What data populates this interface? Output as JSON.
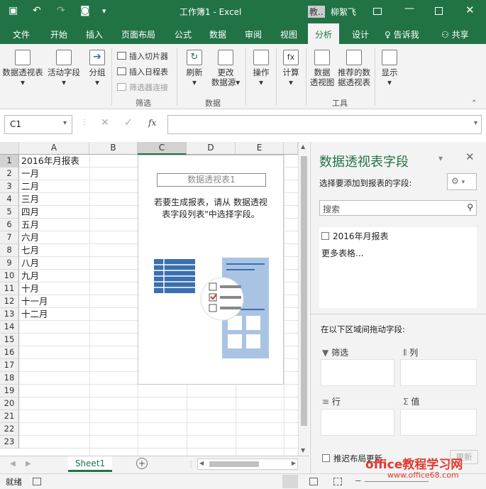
{
  "window": {
    "title": "工作簿1 - Excel",
    "user_short": "教..",
    "user": "柳絮飞"
  },
  "tabs": [
    "文件",
    "开始",
    "插入",
    "页面布局",
    "公式",
    "数据",
    "审阅",
    "视图",
    "分析",
    "设计"
  ],
  "tell_me": "告诉我",
  "share": "共享",
  "ribbon": {
    "pivot_table": "数据透视表",
    "active_field": "活动字段",
    "group": "分组",
    "insert_slicer": "插入切片器",
    "insert_timeline": "插入日程表",
    "filter_connections": "筛选器连接",
    "filter_group": "筛选",
    "refresh": "刷新",
    "change_source_1": "更改",
    "change_source_2": "数据源",
    "data_group": "数据",
    "actions": "操作",
    "calculations": "计算",
    "pivot_chart_1": "数据",
    "pivot_chart_2": "透视图",
    "recommended_1": "推荐的数",
    "recommended_2": "据透视表",
    "tools_group": "工具",
    "show": "显示"
  },
  "formula_bar": {
    "name_box": "C1",
    "fx": "fx"
  },
  "columns": [
    "A",
    "B",
    "C",
    "D",
    "E"
  ],
  "rows": [
    "1",
    "2",
    "3",
    "4",
    "5",
    "6",
    "7",
    "8",
    "9",
    "10",
    "11",
    "12",
    "13",
    "14",
    "15",
    "16",
    "17",
    "18",
    "19",
    "20",
    "21",
    "22",
    "23"
  ],
  "cells_a": [
    "2016年月报表",
    "一月",
    "二月",
    "三月",
    "四月",
    "五月",
    "六月",
    "七月",
    "八月",
    "九月",
    "十月",
    "十一月",
    "十二月"
  ],
  "pivot_placeholder": {
    "title": "数据透视表1",
    "message_1": "若要生成报表，请从 数据透视",
    "message_2": "表字段列表\"中选择字段。"
  },
  "sheet_tab": "Sheet1",
  "status": {
    "ready": "就绪"
  },
  "panel": {
    "title": "数据透视表字段",
    "choose_fields": "选择要添加到报表的字段:",
    "search_placeholder": "搜索",
    "field_1": "2016年月报表",
    "more_tables": "更多表格...",
    "drag_hint": "在以下区域间拖动字段:",
    "filters": "筛选",
    "columns": "列",
    "rows": "行",
    "values": "值",
    "defer_update": "推迟布局更新",
    "update_button": "更新"
  },
  "watermark": {
    "line1": "office教程学习网",
    "line2": "www.office68.com"
  }
}
